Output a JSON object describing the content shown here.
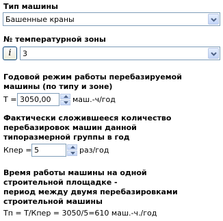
{
  "machine_type": {
    "label": "Тип машины",
    "value": "Башенные краны"
  },
  "temp_zone": {
    "label": "№ температурной зоны",
    "info_button_glyph": "i",
    "value": "3"
  },
  "annual_mode": {
    "heading_line1": "Годовой режим работы перебазируемой",
    "heading_line2": "машины (по типу и зоне)",
    "field_label": "Т =",
    "value": "3050,00",
    "unit": "маш.-ч/год"
  },
  "relocations": {
    "heading_line1": "Фактически сложившееся количество",
    "heading_line2": "перебазировок машин данной",
    "heading_line3": "типоразмерной группы в год",
    "field_label": "Кпер =",
    "value": "5",
    "unit": "раз/год"
  },
  "site_time": {
    "heading_line1": "Время работы машины на одной",
    "heading_line2": "строительной площадке -",
    "heading_line3": "период между двумя перебазировками",
    "heading_line4": "строительной машины",
    "formula": "Тп = Т/Кпер = 3050/5=610 маш.-ч./год"
  },
  "colors": {
    "border": "#7f9db9",
    "button_gradient_top": "#e5eefd",
    "button_gradient_bottom": "#c2d4f7",
    "arrow": "#4d6185"
  },
  "icons": {
    "dropdown_arrow": "chevron-down-icon",
    "spin_up": "triangle-up-icon",
    "spin_down": "triangle-down-icon",
    "info_button": "italic-l-icon"
  }
}
